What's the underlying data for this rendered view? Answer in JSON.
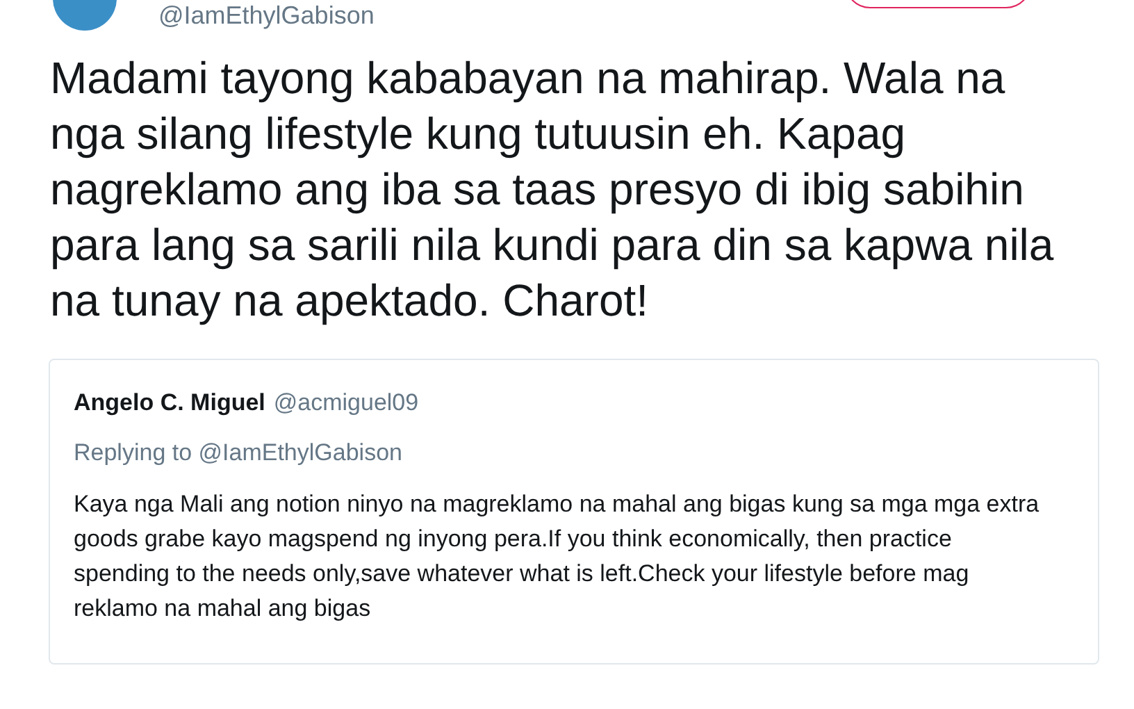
{
  "author": {
    "handle": "@IamEthylGabison"
  },
  "tweet": {
    "text": "Madami tayong kababayan na mahirap. Wala na nga silang lifestyle kung tutuusin eh. Kapag nagreklamo ang iba sa taas presyo di ibig sabihin para lang sa sarili nila kundi para din sa kapwa nila na tunay na apektado. Charot!"
  },
  "quoted_tweet": {
    "name": "Angelo C. Miguel",
    "handle": "@acmiguel09",
    "replying_to": "Replying to @IamEthylGabison",
    "text": "Kaya nga Mali ang notion ninyo na magreklamo na mahal ang bigas kung sa mga mga extra goods grabe kayo magspend ng inyong pera.If you think economically, then practice spending to the needs only,save whatever what is left.Check your lifestyle before mag reklamo na mahal ang bigas"
  }
}
